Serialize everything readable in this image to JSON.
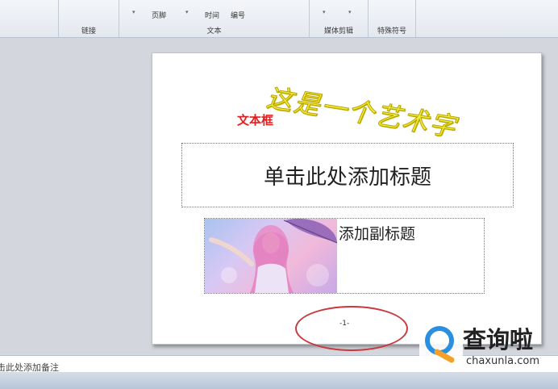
{
  "ribbon": {
    "items": {
      "header_footer": "页脚",
      "datetime": "时间",
      "number": "编号"
    },
    "groups": {
      "links": "链接",
      "text": "文本",
      "media": "媒体剪辑",
      "symbols": "特殊符号"
    }
  },
  "slide": {
    "wordart": "这是一个艺术字",
    "textbox": "文本框",
    "title_placeholder": "单击此处添加标题",
    "subtitle_placeholder": "添加副标题",
    "page_number": "-1-"
  },
  "notes": {
    "placeholder": "击此处添加备注"
  },
  "watermark": {
    "text": "查询啦",
    "url": "chaxunla.com"
  },
  "colors": {
    "wordart_fill": "#f2ee3a",
    "textbox_text": "#e02020",
    "annotation_circle": "#c8383d"
  }
}
